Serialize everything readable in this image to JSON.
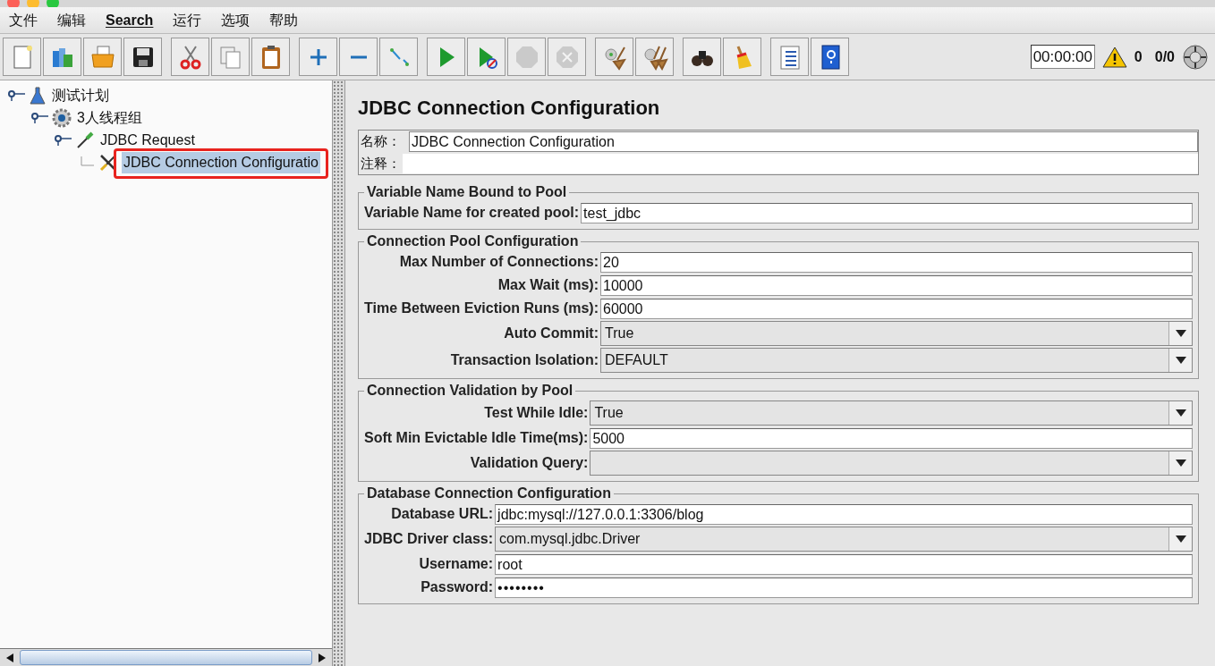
{
  "menu": [
    {
      "label": "文件",
      "mnemonic": false
    },
    {
      "label": "编辑",
      "mnemonic": false
    },
    {
      "label": "Search",
      "mnemonic": true
    },
    {
      "label": "运行",
      "mnemonic": false
    },
    {
      "label": "选项",
      "mnemonic": false
    },
    {
      "label": "帮助",
      "mnemonic": false
    }
  ],
  "toolbar": [
    [
      {
        "kind": "new",
        "disabled": false
      },
      {
        "kind": "templates",
        "disabled": false
      },
      {
        "kind": "open",
        "disabled": false
      },
      {
        "kind": "save",
        "disabled": false
      }
    ],
    [
      {
        "kind": "cut",
        "disabled": false
      },
      {
        "kind": "copy",
        "disabled": false
      },
      {
        "kind": "paste",
        "disabled": false
      }
    ],
    [
      {
        "kind": "expand",
        "disabled": false
      },
      {
        "kind": "collapse",
        "disabled": false
      },
      {
        "kind": "toggle",
        "disabled": false
      }
    ],
    [
      {
        "kind": "start",
        "disabled": false
      },
      {
        "kind": "start-no-pause",
        "disabled": false
      },
      {
        "kind": "stop",
        "disabled": true
      },
      {
        "kind": "shutdown",
        "disabled": true
      }
    ],
    [
      {
        "kind": "clear",
        "disabled": false
      },
      {
        "kind": "clear-all",
        "disabled": false
      }
    ],
    [
      {
        "kind": "search",
        "disabled": false
      },
      {
        "kind": "reset-search",
        "disabled": false
      }
    ],
    [
      {
        "kind": "function-helper",
        "disabled": false
      },
      {
        "kind": "help",
        "disabled": false
      }
    ]
  ],
  "status": {
    "timer": "00:00:00",
    "warnings": "0",
    "threads": "0/0"
  },
  "tree": [
    {
      "label": "测试计划",
      "kind": "plan",
      "selected": false,
      "children": [
        {
          "label": "3人线程组",
          "kind": "thread-group",
          "selected": false,
          "children": [
            {
              "label": "JDBC Request",
              "kind": "sampler",
              "selected": false,
              "children": [
                {
                  "label": "JDBC Connection Configuratio",
                  "kind": "config",
                  "selected": true,
                  "highlighted": true
                }
              ]
            }
          ]
        }
      ]
    }
  ],
  "panel": {
    "title": "JDBC Connection Configuration",
    "name_label": "名称：",
    "name_value": "JDBC Connection Configuration",
    "comment_label": "注释：",
    "sections": [
      {
        "title": "Variable Name Bound to Pool",
        "fields": [
          {
            "label": "Variable Name for created pool:",
            "value": "test_jdbc",
            "kind": "text"
          }
        ]
      },
      {
        "title": "Connection Pool Configuration",
        "fields": [
          {
            "label": "Max Number of Connections:",
            "value": "20",
            "kind": "text"
          },
          {
            "label": "Max Wait (ms):",
            "value": "10000",
            "kind": "text"
          },
          {
            "label": "Time Between Eviction Runs (ms):",
            "value": "60000",
            "kind": "text"
          },
          {
            "label": "Auto Commit:",
            "value": "True",
            "kind": "select"
          },
          {
            "label": "Transaction Isolation:",
            "value": "DEFAULT",
            "kind": "select"
          }
        ]
      },
      {
        "title": "Connection Validation by Pool",
        "fields": [
          {
            "label": "Test While Idle:",
            "value": "True",
            "kind": "select"
          },
          {
            "label": "Soft Min Evictable Idle Time(ms):",
            "value": "5000",
            "kind": "text"
          },
          {
            "label": "Validation Query:",
            "kind": "select"
          }
        ]
      },
      {
        "title": "Database Connection Configuration",
        "fields": [
          {
            "label": "Database URL:",
            "value": "jdbc:mysql://127.0.0.1:3306/blog",
            "kind": "text"
          },
          {
            "label": "JDBC Driver class:",
            "value": "com.mysql.jdbc.Driver",
            "kind": "select"
          },
          {
            "label": "Username:",
            "value": "root",
            "kind": "text"
          },
          {
            "label": "Password:",
            "value": "••••••••",
            "kind": "password"
          }
        ]
      }
    ]
  }
}
